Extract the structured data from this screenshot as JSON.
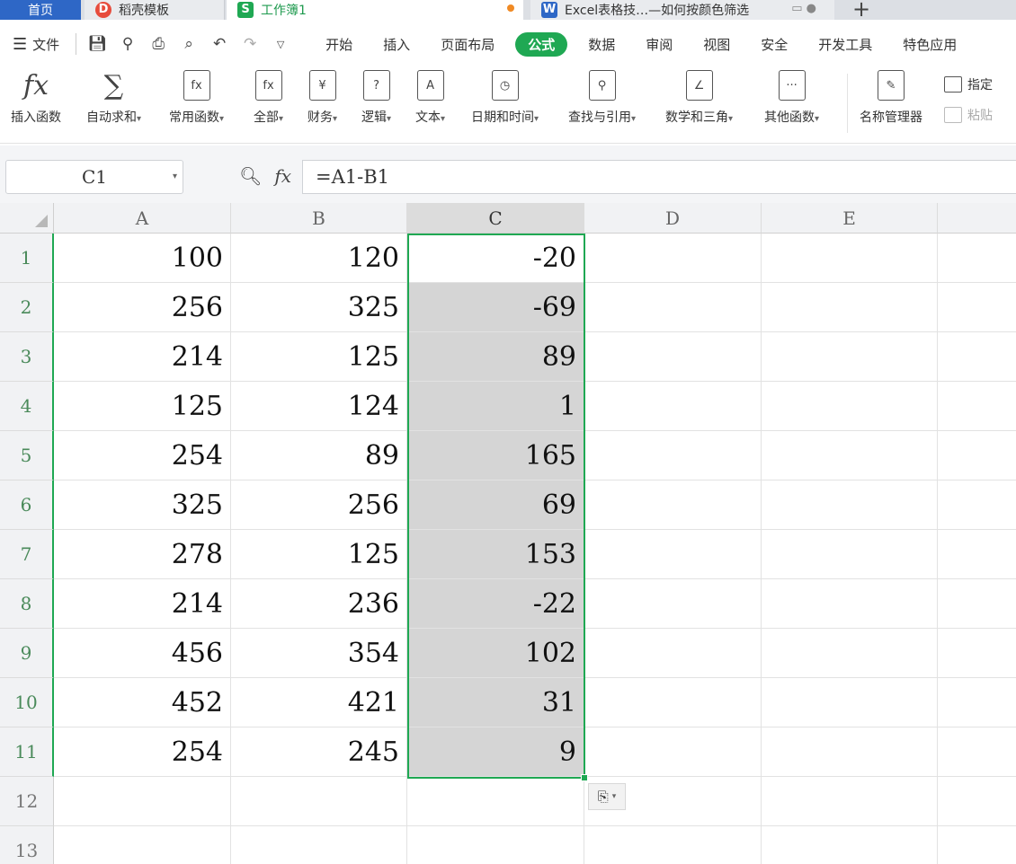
{
  "tabs": {
    "home": "首页",
    "template": "稻壳模板",
    "workbook": "工作簿1",
    "doc": "Excel表格技…—如何按颜色筛选",
    "add": "+"
  },
  "menubar": {
    "file": "文件",
    "items": [
      "开始",
      "插入",
      "页面布局",
      "公式",
      "数据",
      "审阅",
      "视图",
      "安全",
      "开发工具",
      "特色应用"
    ],
    "active": "公式"
  },
  "ribbon": {
    "buttons": [
      {
        "label": "插入函数",
        "icon": "fx"
      },
      {
        "label": "自动求和",
        "icon": "∑",
        "dropdown": true
      },
      {
        "label": "常用函数",
        "icon": "fx",
        "dropdown": true
      },
      {
        "label": "全部",
        "icon": "fx",
        "dropdown": true
      },
      {
        "label": "财务",
        "icon": "¥",
        "dropdown": true
      },
      {
        "label": "逻辑",
        "icon": "?",
        "dropdown": true
      },
      {
        "label": "文本",
        "icon": "A",
        "dropdown": true
      },
      {
        "label": "日期和时间",
        "icon": "◷",
        "dropdown": true
      },
      {
        "label": "查找与引用",
        "icon": "⚲",
        "dropdown": true
      },
      {
        "label": "数学和三角",
        "icon": "∠",
        "dropdown": true
      },
      {
        "label": "其他函数",
        "icon": "···",
        "dropdown": true
      },
      {
        "label": "名称管理器",
        "icon": "✎"
      }
    ],
    "side": [
      {
        "label": "指定"
      },
      {
        "label": "粘贴"
      }
    ]
  },
  "formula_bar": {
    "name_box": "C1",
    "formula": "=A1-B1"
  },
  "sheet": {
    "columns": [
      "A",
      "B",
      "C",
      "D",
      "E"
    ],
    "selected_column": "C",
    "rows": [
      {
        "n": "1",
        "a": "100",
        "b": "120",
        "c": "-20"
      },
      {
        "n": "2",
        "a": "256",
        "b": "325",
        "c": "-69"
      },
      {
        "n": "3",
        "a": "214",
        "b": "125",
        "c": "89"
      },
      {
        "n": "4",
        "a": "125",
        "b": "124",
        "c": "1"
      },
      {
        "n": "5",
        "a": "254",
        "b": "89",
        "c": "165"
      },
      {
        "n": "6",
        "a": "325",
        "b": "256",
        "c": "69"
      },
      {
        "n": "7",
        "a": "278",
        "b": "125",
        "c": "153"
      },
      {
        "n": "8",
        "a": "214",
        "b": "236",
        "c": "-22"
      },
      {
        "n": "9",
        "a": "456",
        "b": "354",
        "c": "102"
      },
      {
        "n": "10",
        "a": "452",
        "b": "421",
        "c": "31"
      },
      {
        "n": "11",
        "a": "254",
        "b": "245",
        "c": "9"
      },
      {
        "n": "12",
        "a": "",
        "b": "",
        "c": ""
      },
      {
        "n": "13",
        "a": "",
        "b": "",
        "c": ""
      }
    ]
  },
  "colors": {
    "accent": "#1fa853",
    "tab_blue": "#2e67c6",
    "selection_fill": "#d5d5d5"
  }
}
